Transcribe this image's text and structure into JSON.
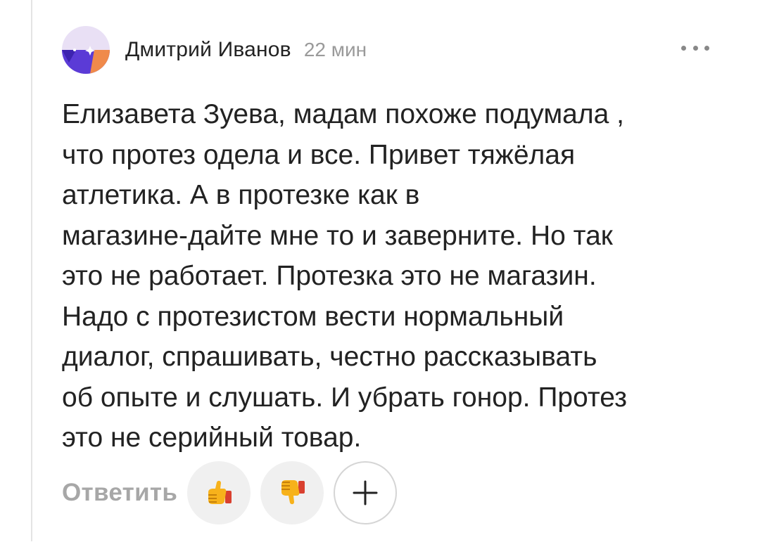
{
  "comment": {
    "author": "Дмитрий Иванов",
    "time": "22 мин",
    "text": "Елизавета Зуева, мадам похоже подумала ,\nчто протез одела и все. Привет тяжёлая\nатлетика. А в протезке как в\nмагазине-дайте мне то и заверните. Но так\nэто не работает. Протезка это не магазин.\nНадо с протезистом вести нормальный\nдиалог, спрашивать, честно рассказывать\nоб опыте и слушать. И убрать гонор. Протез\nэто не серийный товар.",
    "more_icon": "more-dots-icon"
  },
  "actions": {
    "reply_label": "Ответить",
    "like_icon": "thumbs-up-icon",
    "dislike_icon": "thumbs-down-icon",
    "add_icon": "plus-icon"
  },
  "colors": {
    "text": "#222222",
    "muted": "#9a9a9a",
    "reply": "#a7a7a7",
    "reaction_bg": "#f0f0f0",
    "avatar_top": "#e9e0f5",
    "avatar_bottom": "#5b3bd6",
    "avatar_accent": "#f08a4b"
  }
}
